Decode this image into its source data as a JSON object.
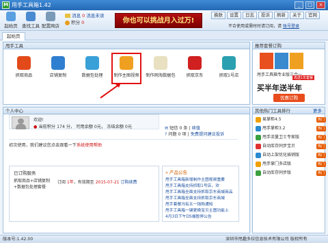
{
  "window": {
    "app_icon": "M",
    "title": "甩手工具箱1.42",
    "min": "_",
    "max": "□",
    "close": "×"
  },
  "toolbar": {
    "buttons": [
      {
        "label": "起始页",
        "icon": "home-icon"
      },
      {
        "label": "查找工具",
        "icon": "search-icon"
      },
      {
        "label": "配置网店",
        "icon": "gear-icon"
      }
    ],
    "messages_label": "消息",
    "messages_count": "0",
    "points_label": "积分",
    "points_value": "0",
    "unread_label": "消息未读",
    "banner": "你也可以挑战月入过万!",
    "right_buttons": [
      "换肤",
      "设置",
      "日志",
      "投诉",
      "刷新",
      "关于",
      "官网"
    ],
    "autologin_text": "不合使用或需时时请订阅，请",
    "autologin_link": "账号登录"
  },
  "tabs": {
    "home": "起始页"
  },
  "tools_panel": {
    "title": "甩手工具",
    "tools": [
      {
        "label": "抓取商品",
        "icon": "grab-goods-icon",
        "color": "#e24a1a"
      },
      {
        "label": "店铺复制",
        "icon": "store-copy-icon",
        "color": "#2f7fd0"
      },
      {
        "label": "数据包处理",
        "icon": "data-package-icon",
        "color": "#3aa0d8"
      },
      {
        "label": "制作主图视频",
        "icon": "video-make-icon",
        "color": "#f0a020"
      },
      {
        "label": "制作网淘数据包",
        "icon": "taobao-data-icon",
        "color": "#e8e0c0"
      },
      {
        "label": "抓取京东",
        "icon": "jd-grab-icon",
        "color": "#d02020"
      },
      {
        "label": "抓取1号店",
        "icon": "yhd-grab-icon",
        "color": "#2aa0b0"
      }
    ]
  },
  "personal_panel": {
    "title": "个人中心",
    "welcome": "欢迎!",
    "points_text": "当前积分 174 分，",
    "usable_text": "可用余额 0元，",
    "frozen_text": "冻结余额 0元",
    "sms_label": "短信",
    "sms_value": "0 条",
    "sms_link": "续值",
    "qq_label": "问题",
    "qq_value": "0 项",
    "qq_link": "免费提问建议投诉",
    "hint_prefix": "初次使用，我们建议您点击观看一下",
    "hint_link": "系统使用帮助",
    "orders_title": "已订购服务",
    "order_name": "抓取商品+店铺复制+数据包处理套餐",
    "order_status": "订阅",
    "order_period": "1年",
    "order_expire_label": "有效期至",
    "order_expire": "2015-07-21",
    "order_action": "订购续费",
    "news_title": "产品公告",
    "news": [
      "甩手工具箱新增制作主图视频重要",
      "甩手工具箱支持抓取1号店，欢",
      "甩手工具箱全面支持抓取京东商城商品",
      "甩手工具箱全面支持抓取京东商城",
      "甩手套餐冯有五一钱购通知",
      "甩手工具箱一键更换宝贝主图功能上",
      "4月3日下午DS端暂停公告"
    ]
  },
  "recommend_panel": {
    "title": "推荐套餐订购",
    "product_name": "甩手工具箱专业版三合一",
    "promo_tag": "再送1年套餐",
    "promo_big": "买半年送半年",
    "order_button": "优惠订购"
  },
  "rank_panel": {
    "title": "其他热门工具排行",
    "more": "更多",
    "items": [
      {
        "label": "易掌柜4.5",
        "color": "#f0a000"
      },
      {
        "label": "甩手掌柜3.2",
        "color": "#2a8ad0"
      },
      {
        "label": "甩手流量卫士专家版",
        "color": "#3aa040"
      },
      {
        "label": "自动库存同步宝贝",
        "color": "#e03030"
      },
      {
        "label": "自动上架优化插销版",
        "color": "#2a8ad0"
      },
      {
        "label": "甩手掌门多店版",
        "color": "#f0a000"
      },
      {
        "label": "自动库存同步版",
        "color": "#3aa040"
      }
    ],
    "hot_label": "热门"
  },
  "statusbar": {
    "version": "版本号:1.42.00",
    "company": "深圳市甩趣多拉信息技术有限公司 版权所有"
  }
}
